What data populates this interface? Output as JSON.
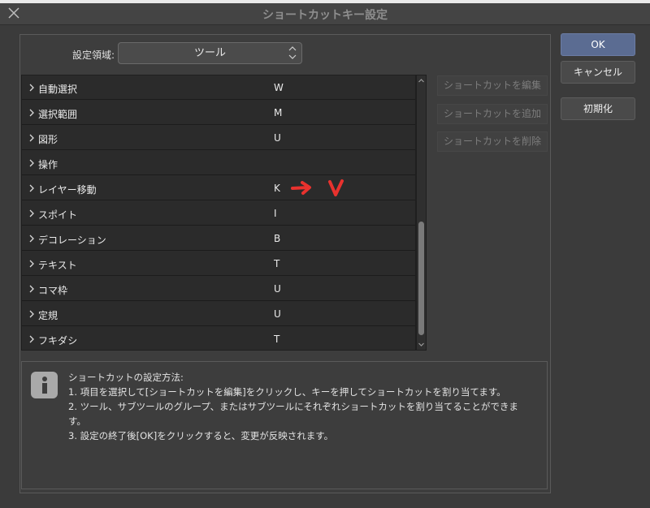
{
  "window": {
    "title": "ショートカットキー設定"
  },
  "settings_area": {
    "label": "設定領域:",
    "value": "ツール"
  },
  "shortcut_list": [
    {
      "name": "自動選択",
      "key": "W"
    },
    {
      "name": "選択範囲",
      "key": "M"
    },
    {
      "name": "図形",
      "key": "U"
    },
    {
      "name": "操作",
      "key": ""
    },
    {
      "name": "レイヤー移動",
      "key": "K"
    },
    {
      "name": "スポイト",
      "key": "I"
    },
    {
      "name": "デコレーション",
      "key": "B"
    },
    {
      "name": "テキスト",
      "key": "T"
    },
    {
      "name": "コマ枠",
      "key": "U"
    },
    {
      "name": "定規",
      "key": "U"
    },
    {
      "name": "フキダシ",
      "key": "T"
    }
  ],
  "side_buttons": {
    "edit": "ショートカットを編集",
    "add": "ショートカットを追加",
    "delete": "ショートカットを削除"
  },
  "dialog_buttons": {
    "ok": "OK",
    "cancel": "キャンセル",
    "reset": "初期化"
  },
  "help": {
    "heading": "ショートカットの設定方法:",
    "lines": [
      "1. 項目を選択して[ショートカットを編集]をクリックし、キーを押してショートカットを割り当てます。",
      "2. ツール、サブツールのグループ、またはサブツールにそれぞれショートカットを割り当てることができま",
      "す。",
      "3. 設定の終了後[OK]をクリックすると、変更が反映されます。"
    ]
  },
  "annotation": {
    "color": "#e8322e"
  },
  "colors": {
    "ok_button": "#5b6c92",
    "background": "#3b3b3b",
    "list_background": "#2b2b2b"
  },
  "icons": {
    "close": "close-icon",
    "info": "info-icon",
    "row_expand": "chevron-right-icon",
    "select": "updown-chevron-icon"
  }
}
